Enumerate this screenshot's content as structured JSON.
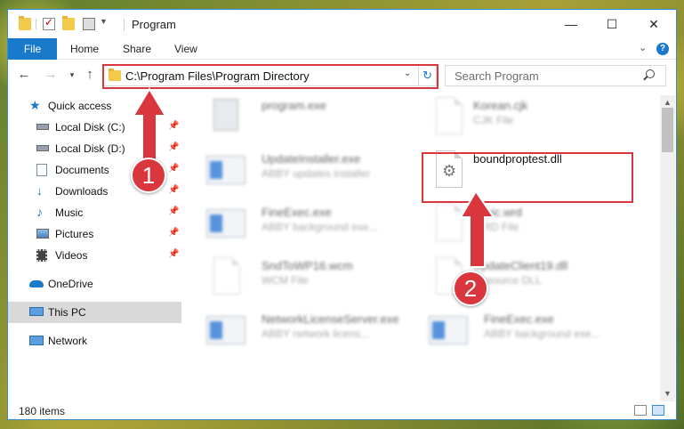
{
  "window": {
    "title": "Program",
    "controls": {
      "minimize": "—",
      "maximize": "☐",
      "close": "✕"
    }
  },
  "ribbon": {
    "tabs": [
      "File",
      "Home",
      "Share",
      "View"
    ],
    "help": "?"
  },
  "address_bar": {
    "path": "C:\\Program Files\\Program Directory",
    "search_placeholder": "Search Program"
  },
  "sidebar": {
    "items": [
      {
        "label": "Quick access",
        "icon": "star-icon",
        "pinned": false
      },
      {
        "label": "Local Disk (C:)",
        "icon": "drive-icon",
        "pinned": true
      },
      {
        "label": "Local Disk (D:)",
        "icon": "drive-icon",
        "pinned": true
      },
      {
        "label": "Documents",
        "icon": "documents-icon",
        "pinned": true
      },
      {
        "label": "Downloads",
        "icon": "download-icon",
        "pinned": true
      },
      {
        "label": "Music",
        "icon": "music-icon",
        "pinned": true
      },
      {
        "label": "Pictures",
        "icon": "pictures-icon",
        "pinned": true
      },
      {
        "label": "Videos",
        "icon": "videos-icon",
        "pinned": true
      },
      {
        "label": "OneDrive",
        "icon": "cloud-icon",
        "pinned": false
      },
      {
        "label": "This PC",
        "icon": "computer-icon",
        "pinned": false,
        "selected": true
      },
      {
        "label": "Network",
        "icon": "network-icon",
        "pinned": false
      }
    ]
  },
  "files": [
    {
      "name": "program.exe",
      "type": "",
      "column": 0
    },
    {
      "name": "UpdateInstaller.exe",
      "type": "ABBY updates installer",
      "column": 0
    },
    {
      "name": "FineExec.exe",
      "type": "ABBY background exe...",
      "column": 0
    },
    {
      "name": "SndToWP16.wcm",
      "type": "WCM File",
      "column": 0
    },
    {
      "name": "NetworkLicenseServer.exe",
      "type": "ABBY network licens...",
      "column": 0
    },
    {
      "name": "Korean.cjk",
      "type": "CJK File",
      "column": 1
    },
    {
      "name": "boundproptest.dll",
      "type": "",
      "column": 1,
      "highlighted": true
    },
    {
      "name": "Topic.wrd",
      "type": "WRD File",
      "column": 1
    },
    {
      "name": "UpdateClient19.dll",
      "type": "Resource DLL",
      "column": 1
    },
    {
      "name": "FineExec.exe",
      "type": "ABBY background exe...",
      "column": 1
    }
  ],
  "status": {
    "item_count": "180 items"
  },
  "callouts": [
    "1",
    "2"
  ],
  "colors": {
    "accent": "#1979ca",
    "callout": "#d9363e"
  }
}
